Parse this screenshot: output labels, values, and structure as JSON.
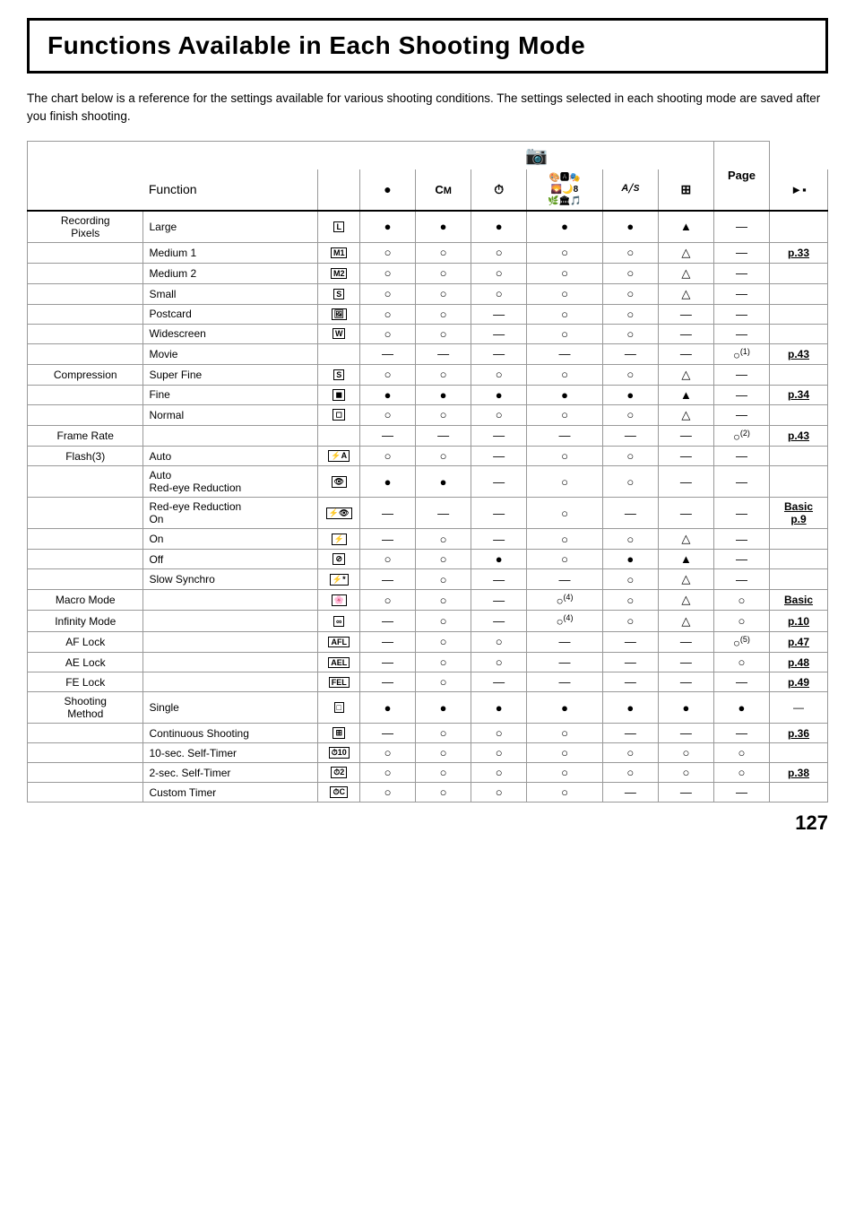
{
  "title": "Functions Available in Each Shooting Mode",
  "description": "The chart below is a reference for the settings available for various shooting conditions. The settings selected in each shooting mode are saved after you finish shooting.",
  "page_number": "127",
  "table": {
    "col_headers": [
      "Function",
      "",
      "●",
      "CM",
      "☀",
      "🎨🅰🎭\n🌄🌙8\n🌿🏛🎵",
      "A/S",
      "⊡",
      "▶▪",
      "Page"
    ],
    "rows": [
      {
        "group": "Recording\nPixels",
        "name": "Large",
        "icon": "L",
        "c1": "●",
        "c2": "●",
        "c3": "●",
        "c4": "●",
        "c5": "●",
        "c6": "▲",
        "c7": "—",
        "page": ""
      },
      {
        "group": "",
        "name": "Medium 1",
        "icon": "M1",
        "c1": "○",
        "c2": "○",
        "c3": "○",
        "c4": "○",
        "c5": "○",
        "c6": "△",
        "c7": "—",
        "page": "p.33"
      },
      {
        "group": "",
        "name": "Medium 2",
        "icon": "M2",
        "c1": "○",
        "c2": "○",
        "c3": "○",
        "c4": "○",
        "c5": "○",
        "c6": "△",
        "c7": "—",
        "page": ""
      },
      {
        "group": "",
        "name": "Small",
        "icon": "S",
        "c1": "○",
        "c2": "○",
        "c3": "○",
        "c4": "○",
        "c5": "○",
        "c6": "△",
        "c7": "—",
        "page": ""
      },
      {
        "group": "",
        "name": "Postcard",
        "icon": "🖼",
        "c1": "○",
        "c2": "○",
        "c3": "—",
        "c4": "○",
        "c5": "○",
        "c6": "—",
        "c7": "—",
        "page": ""
      },
      {
        "group": "",
        "name": "Widescreen",
        "icon": "W",
        "c1": "○",
        "c2": "○",
        "c3": "—",
        "c4": "○",
        "c5": "○",
        "c6": "—",
        "c7": "—",
        "page": ""
      },
      {
        "group": "",
        "name": "Movie",
        "icon": "",
        "c1": "—",
        "c2": "—",
        "c3": "—",
        "c4": "—",
        "c5": "—",
        "c6": "—",
        "c7": "○(1)",
        "page": "p.43"
      },
      {
        "group": "Compression",
        "name": "Super Fine",
        "icon": "S",
        "c1": "○",
        "c2": "○",
        "c3": "○",
        "c4": "○",
        "c5": "○",
        "c6": "△",
        "c7": "—",
        "page": ""
      },
      {
        "group": "",
        "name": "Fine",
        "icon": "◼",
        "c1": "●",
        "c2": "●",
        "c3": "●",
        "c4": "●",
        "c5": "●",
        "c6": "▲",
        "c7": "—",
        "page": "p.34"
      },
      {
        "group": "",
        "name": "Normal",
        "icon": "◻",
        "c1": "○",
        "c2": "○",
        "c3": "○",
        "c4": "○",
        "c5": "○",
        "c6": "△",
        "c7": "—",
        "page": ""
      },
      {
        "group": "Frame Rate",
        "name": "",
        "icon": "",
        "c1": "—",
        "c2": "—",
        "c3": "—",
        "c4": "—",
        "c5": "—",
        "c6": "—",
        "c7": "○(2)",
        "page": "p.43"
      },
      {
        "group": "Flash(3)",
        "name": "Auto",
        "icon": "⚡A",
        "c1": "○",
        "c2": "○",
        "c3": "—",
        "c4": "○",
        "c5": "○",
        "c6": "—",
        "c7": "—",
        "page": ""
      },
      {
        "group": "",
        "name": "Auto\nRed-eye Reduction",
        "icon": "👁",
        "c1": "●",
        "c2": "●",
        "c3": "—",
        "c4": "○",
        "c5": "○",
        "c6": "—",
        "c7": "—",
        "page": ""
      },
      {
        "group": "",
        "name": "Red-eye Reduction\nOn",
        "icon": "⚡👁",
        "c1": "—",
        "c2": "—",
        "c3": "—",
        "c4": "○",
        "c5": "—",
        "c6": "—",
        "c7": "—",
        "page": "Basic\np.9"
      },
      {
        "group": "",
        "name": "On",
        "icon": "⚡",
        "c1": "—",
        "c2": "○",
        "c3": "—",
        "c4": "○",
        "c5": "○",
        "c6": "△",
        "c7": "—",
        "page": ""
      },
      {
        "group": "",
        "name": "Off",
        "icon": "⊘",
        "c1": "○",
        "c2": "○",
        "c3": "●",
        "c4": "○",
        "c5": "●",
        "c6": "▲",
        "c7": "—",
        "page": ""
      },
      {
        "group": "",
        "name": "Slow Synchro",
        "icon": "⚡*",
        "c1": "—",
        "c2": "○",
        "c3": "—",
        "c4": "—",
        "c5": "○",
        "c6": "△",
        "c7": "—",
        "page": ""
      },
      {
        "group": "Macro Mode",
        "name": "",
        "icon": "🌸",
        "c1": "○",
        "c2": "○",
        "c3": "—",
        "c4": "○(4)",
        "c5": "○",
        "c6": "△",
        "c7": "○",
        "page": "Basic"
      },
      {
        "group": "Infinity Mode",
        "name": "",
        "icon": "∞",
        "c1": "—",
        "c2": "○",
        "c3": "—",
        "c4": "○(4)",
        "c5": "○",
        "c6": "△",
        "c7": "○",
        "page": "p.10"
      },
      {
        "group": "AF Lock",
        "name": "",
        "icon": "AFL",
        "c1": "—",
        "c2": "○",
        "c3": "○",
        "c4": "—",
        "c5": "—",
        "c6": "—",
        "c7": "○(5)",
        "page": "p.47"
      },
      {
        "group": "AE Lock",
        "name": "",
        "icon": "AEL",
        "c1": "—",
        "c2": "○",
        "c3": "○",
        "c4": "—",
        "c5": "—",
        "c6": "—",
        "c7": "○",
        "page": "p.48"
      },
      {
        "group": "FE Lock",
        "name": "",
        "icon": "FEL",
        "c1": "—",
        "c2": "○",
        "c3": "—",
        "c4": "—",
        "c5": "—",
        "c6": "—",
        "c7": "—",
        "page": "p.49"
      },
      {
        "group": "Shooting\nMethod",
        "name": "Single",
        "icon": "□",
        "c1": "●",
        "c2": "●",
        "c3": "●",
        "c4": "●",
        "c5": "●",
        "c6": "●",
        "c7": "●",
        "page": "—"
      },
      {
        "group": "",
        "name": "Continuous Shooting",
        "icon": "⊞",
        "c1": "—",
        "c2": "○",
        "c3": "○",
        "c4": "○",
        "c5": "—",
        "c6": "—",
        "c7": "—",
        "page": "p.36"
      },
      {
        "group": "",
        "name": "10-sec. Self-Timer",
        "icon": "⏱10",
        "c1": "○",
        "c2": "○",
        "c3": "○",
        "c4": "○",
        "c5": "○",
        "c6": "○",
        "c7": "○",
        "page": ""
      },
      {
        "group": "",
        "name": "2-sec. Self-Timer",
        "icon": "⏱2",
        "c1": "○",
        "c2": "○",
        "c3": "○",
        "c4": "○",
        "c5": "○",
        "c6": "○",
        "c7": "○",
        "page": "p.38"
      },
      {
        "group": "",
        "name": "Custom Timer",
        "icon": "⏱C",
        "c1": "○",
        "c2": "○",
        "c3": "○",
        "c4": "○",
        "c5": "—",
        "c6": "—",
        "c7": "—",
        "page": ""
      }
    ]
  }
}
